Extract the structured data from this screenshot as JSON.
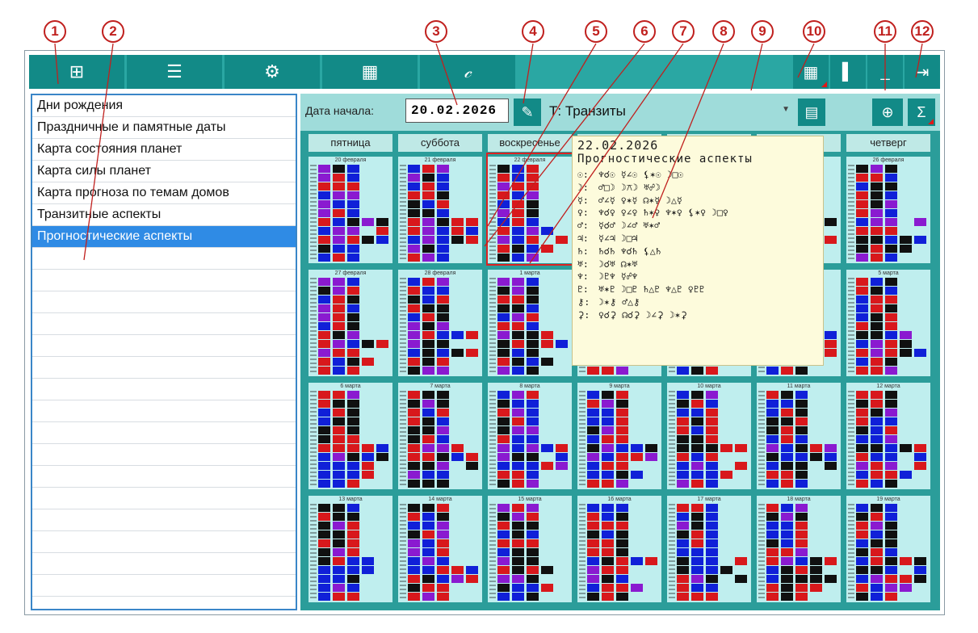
{
  "callouts": [
    "1",
    "2",
    "3",
    "4",
    "5",
    "6",
    "7",
    "8",
    "9",
    "10",
    "11",
    "12"
  ],
  "toolbar": {
    "icons": [
      "layout-grid-icon",
      "list-icon",
      "gear-icon",
      "calculator-icon",
      "script-logo-icon"
    ],
    "glyphs": [
      "⊞",
      "☰",
      "⚙",
      "▦",
      "𝒸"
    ],
    "right_icons": [
      "grid-9-icon",
      "panel-icon",
      "minimize-icon",
      "exit-icon"
    ],
    "right_glyphs": [
      "▦",
      "▌",
      "_",
      "⇥"
    ]
  },
  "list": {
    "items": [
      "Дни рождения",
      "Праздничные и памятные даты",
      "Карта состояния планет",
      "Карта силы планет",
      "Карта прогноза по темам домов",
      "Транзитные аспекты",
      "Прогностические аспекты"
    ],
    "selected_index": 6
  },
  "controls": {
    "date_label": "Дата начала:",
    "date_value": "20.02.2026",
    "select_value": "Т: Транзиты"
  },
  "weekdays": [
    "пятница",
    "суббота",
    "воскресенье",
    "",
    "",
    "",
    "четверг"
  ],
  "calendar_rows": [
    [
      "20 февраля",
      "21 февраля",
      "22 февраля",
      "",
      "",
      "",
      "26 февраля"
    ],
    [
      "27 февраля",
      "28 февраля",
      "1 марта",
      "",
      "",
      "",
      "5 марта"
    ],
    [
      "6 марта",
      "7 марта",
      "8 марта",
      "9 марта",
      "10 марта",
      "11 марта",
      "12 марта"
    ],
    [
      "13 марта",
      "14 марта",
      "15 марта",
      "16 марта",
      "17 марта",
      "18 марта",
      "19 марта"
    ]
  ],
  "tooltip": {
    "date": "22.02.2026",
    "title": "Прогностические аспекты",
    "rows": [
      {
        "planet": "☉:",
        "aspects": "♆☌☉  ☿∠☉  ⚸✶☉  ☽□☉"
      },
      {
        "planet": "☽:",
        "aspects": "♂□☽  ☽⚻☽  ♅☍☽"
      },
      {
        "planet": "☿:",
        "aspects": "♂∠☿  ♀✶☿  ☊✶☿  ☽△☿"
      },
      {
        "planet": "♀:",
        "aspects": "♆☌♀  ♀∠♀  ♄✶♀  ♆✶♀  ⚸✶♀  ☽□♀"
      },
      {
        "planet": "♂:",
        "aspects": "☿☌♂  ☽∠♂  ♅✶♂"
      },
      {
        "planet": "♃:",
        "aspects": "☿∠♃  ☽□♃"
      },
      {
        "planet": "♄:",
        "aspects": "♄☌♄  ♆☌♄  ⚸△♄"
      },
      {
        "planet": "♅:",
        "aspects": "☽☌♅  ☊✶♅"
      },
      {
        "planet": "♆:",
        "aspects": "☽♇♆  ☿☍♆"
      },
      {
        "planet": "♇:",
        "aspects": "♅✶♇  ☽□♇  ♄△♇  ♆△♇  ♀♇♇"
      },
      {
        "planet": "⚷:",
        "aspects": "☽✶⚷  ♂△⚷"
      },
      {
        "planet": "⚳:",
        "aspects": "♀☌⚳  ☊☌⚳  ☽∠⚳  ☽✶⚳"
      }
    ]
  },
  "colors": {
    "toolbar_bg": "#2aa7a3",
    "button_bg": "#128a87",
    "panel_bg": "#2b9d9a",
    "cell_bg": "#bfeeee",
    "selected_item": "#2f8be5",
    "callout": "#c0201e",
    "tooltip_bg": "#fdfbdc"
  }
}
